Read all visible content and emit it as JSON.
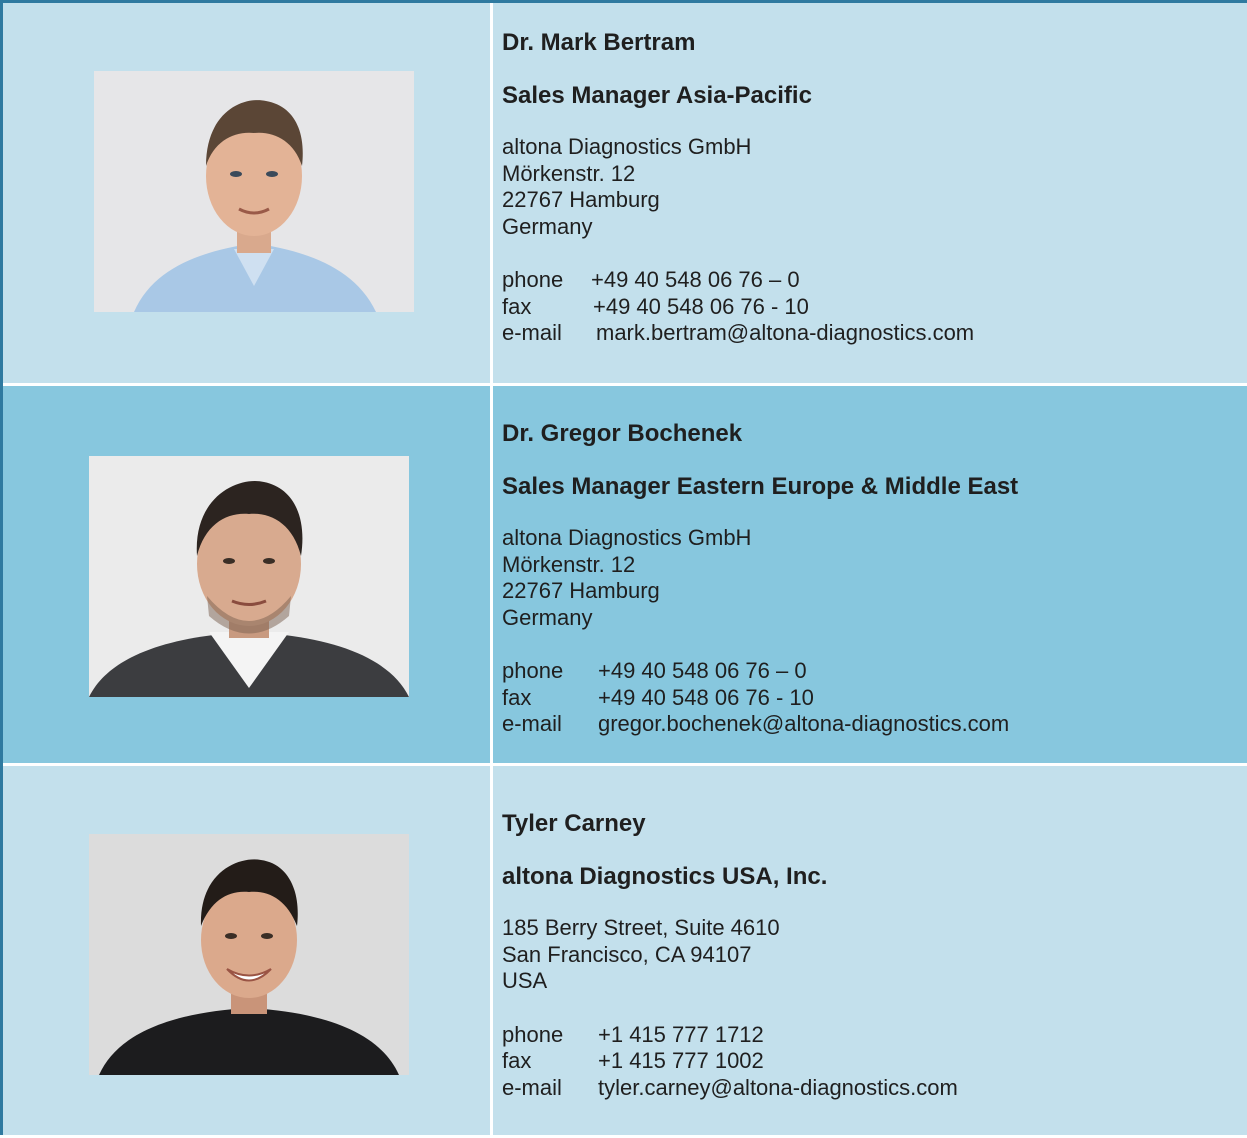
{
  "contacts": [
    {
      "name": "Dr. Mark Bertram",
      "role": "Sales Manager Asia-Pacific",
      "address": [
        "altona Diagnostics GmbH",
        "Mörkenstr. 12",
        "22767 Hamburg",
        "Germany"
      ],
      "phone_label": "phone",
      "phone": "+49 40 548 06 76 – 0",
      "fax_label": "fax",
      "fax": "+49 40 548 06 76 - 10",
      "email_label": "e-mail",
      "email": "mark.bertram@altona-diagnostics.com"
    },
    {
      "name": "Dr. Gregor Bochenek",
      "role": "Sales Manager Eastern Europe & Middle East",
      "address": [
        "altona Diagnostics GmbH",
        "Mörkenstr. 12",
        "22767 Hamburg",
        "Germany"
      ],
      "phone_label": "phone",
      "phone": "+49 40 548 06 76 – 0",
      "fax_label": "fax",
      "fax": "+49 40 548 06 76 - 10",
      "email_label": "e-mail",
      "email": "gregor.bochenek@altona-diagnostics.com"
    },
    {
      "name": "Tyler Carney",
      "role": "altona Diagnostics USA, Inc.",
      "address": [
        "185 Berry Street, Suite 4610",
        "San Francisco, CA 94107",
        "USA"
      ],
      "phone_label": "phone",
      "phone": "+1 415 777 1712",
      "fax_label": "fax",
      "fax": "+1 415 777 1002",
      "email_label": "e-mail",
      "email": "tyler.carney@altona-diagnostics.com"
    }
  ],
  "colors": {
    "border": "#2f7aa0",
    "row_light": "#c3e0ec",
    "row_dark": "#87c7de",
    "text": "#1f1f1f"
  }
}
